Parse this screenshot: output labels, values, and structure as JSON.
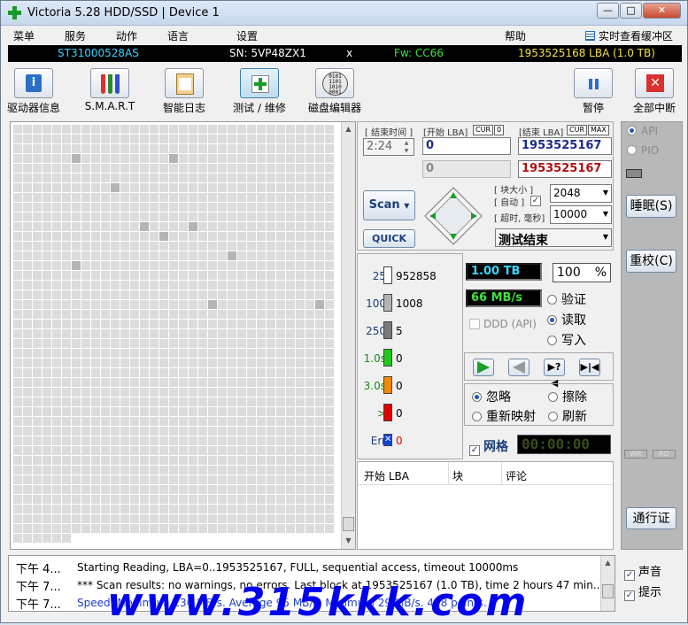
{
  "window": {
    "title": "Victoria 5.28 HDD/SSD | Device 1",
    "min": "—",
    "max": "□",
    "close": "✕"
  },
  "menu": {
    "items": [
      "菜单",
      "服务",
      "动作",
      "语言",
      "设置",
      "帮助"
    ],
    "realtime": "实时查看缓冲区"
  },
  "info": {
    "model": "ST31000528AS",
    "serial": "SN: 5VP48ZX1",
    "x": "x",
    "firmware": "Fw: CC66",
    "lba": "1953525168 LBA (1.0 TB)"
  },
  "toolbar": {
    "drive_info": "驱动器信息",
    "smart": "S.M.A.R.T",
    "smart_log": "智能日志",
    "test": "测试 / 维修",
    "disk_editor": "磁盘编辑器",
    "pause": "暂停",
    "stop_all": "全部中断"
  },
  "controls": {
    "end_time_label": "[ 结束时间 ]",
    "end_time": "2:24",
    "start_lba_label": "[开始 LBA]",
    "cur": "CUR",
    "zero": "0",
    "end_lba_label": "[结束 LBA]",
    "max": "MAX",
    "start_lba": "0",
    "end_lba": "1953525167",
    "start_lba2": "0",
    "end_lba2": "1953525167",
    "block_size_label": "[ 块大小 ]",
    "auto_label": "[ 自动 ]",
    "block_size": "2048",
    "timeout_label": "[ 超时, 毫秒]",
    "timeout": "10000",
    "scan": "Scan",
    "quick": "QUICK",
    "status": "测试结束"
  },
  "stats": [
    {
      "label": "25",
      "count": "952858",
      "color": "#ffffff",
      "labelColor": "#1c3f7a"
    },
    {
      "label": "100",
      "count": "1008",
      "color": "#b4b4b4",
      "labelColor": "#1c3f7a"
    },
    {
      "label": "250",
      "count": "5",
      "color": "#7a7a7a",
      "labelColor": "#1c3f7a"
    },
    {
      "label": "1.0s",
      "count": "0",
      "color": "#22c81e",
      "labelColor": "#1a8a1a"
    },
    {
      "label": "3.0s",
      "count": "0",
      "color": "#f08a00",
      "labelColor": "#1a8a1a"
    },
    {
      "label": ">",
      "count": "0",
      "color": "#e00000",
      "labelColor": "#1a8a1a"
    },
    {
      "label": "Err",
      "count": "0",
      "color": "#1040e0",
      "labelColor": "#1c3f7a"
    }
  ],
  "readouts": {
    "size": "1.00 TB",
    "percent": "100",
    "pct_sign": "%",
    "speed": "66 MB/s"
  },
  "options": {
    "verify": "验证",
    "read": "读取",
    "write": "写入",
    "ddd": "DDD (API)",
    "ignore": "忽略",
    "erase": "擦除",
    "remap": "重新映射",
    "refresh": "刷新",
    "grid": "网格",
    "timer": "00:00:00"
  },
  "table": {
    "headers": [
      "开始 LBA",
      "块",
      "评论"
    ]
  },
  "side": {
    "api": "API",
    "pio": "PIO",
    "sleep": "睡眠(S)",
    "recal": "重校(C)",
    "wr": "WR",
    "rd": "RD",
    "passport": "通行证"
  },
  "log": [
    {
      "time": "下午 4...",
      "msg": "Starting Reading, LBA=0..1953525167, FULL, sequential access, timeout 10000ms",
      "color": "#000000"
    },
    {
      "time": "下午 7...",
      "msg": "*** Scan results: no warnings, no errors. Last block at 1953525167 (1.0 TB), time 2 hours 47 min...",
      "color": "#000000"
    },
    {
      "time": "下午 7...",
      "msg": "Speed: Maximum 130 MB/s. Average 95 MB/s. Minimum 29 MB/s. 418 points.",
      "color": "#1c3fc8"
    }
  ],
  "log_opts": {
    "sound": "声音",
    "hints": "提示"
  },
  "watermark": "www.315kkk.com"
}
